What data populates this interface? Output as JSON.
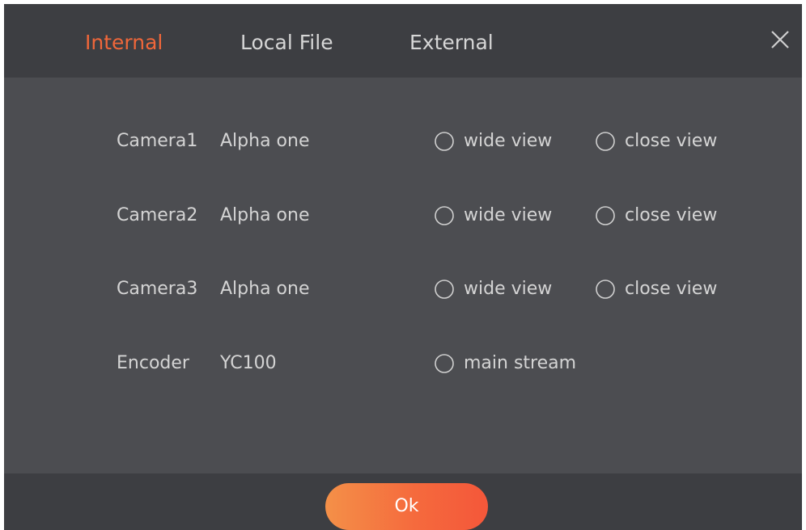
{
  "tabs": [
    {
      "label": "Internal",
      "active": true
    },
    {
      "label": "Local File",
      "active": false
    },
    {
      "label": "External",
      "active": false
    }
  ],
  "close_icon": "close-icon",
  "rows": [
    {
      "label": "Camera1",
      "value": "Alpha one",
      "options": [
        "wide view",
        "close view"
      ]
    },
    {
      "label": "Camera2",
      "value": "Alpha one",
      "options": [
        "wide view",
        "close view"
      ]
    },
    {
      "label": "Camera3",
      "value": "Alpha one",
      "options": [
        "wide view",
        "close view"
      ]
    },
    {
      "label": "Encoder",
      "value": "YC100",
      "options": [
        "main stream"
      ]
    }
  ],
  "footer": {
    "ok_label": "Ok"
  },
  "colors": {
    "accent": "#f0673a",
    "header_bg": "#3d3e42",
    "body_bg": "#4c4d51",
    "text": "#d4d4d4"
  }
}
